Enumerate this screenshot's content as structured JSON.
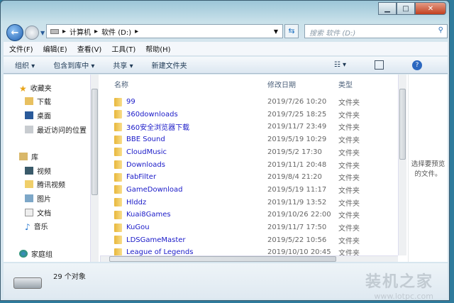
{
  "address": {
    "crumbs": [
      "计算机",
      "软件 (D:)"
    ]
  },
  "search": {
    "placeholder": "搜索 软件 (D:)"
  },
  "menu": [
    "文件(F)",
    "编辑(E)",
    "查看(V)",
    "工具(T)",
    "帮助(H)"
  ],
  "toolbar": {
    "organize": "组织 ▾",
    "include": "包含到库中 ▾",
    "share": "共享 ▾",
    "new_folder": "新建文件夹"
  },
  "nav": {
    "favorites": "收藏夹",
    "downloads": "下载",
    "desktop": "桌面",
    "recent": "最近访问的位置",
    "libraries": "库",
    "videos": "视频",
    "tencent_video": "腾讯视频",
    "pictures": "图片",
    "documents": "文档",
    "music": "音乐",
    "homegroup": "家庭组"
  },
  "columns": {
    "name": "名称",
    "date": "修改日期",
    "type": "类型"
  },
  "files": [
    {
      "name": "99",
      "date": "2019/7/26 10:20",
      "type": "文件夹"
    },
    {
      "name": "360downloads",
      "date": "2019/7/25 18:25",
      "type": "文件夹"
    },
    {
      "name": "360安全浏览器下载",
      "date": "2019/11/7 23:49",
      "type": "文件夹"
    },
    {
      "name": "BBE Sound",
      "date": "2019/5/19 10:29",
      "type": "文件夹"
    },
    {
      "name": "CloudMusic",
      "date": "2019/5/2 17:30",
      "type": "文件夹"
    },
    {
      "name": "Downloads",
      "date": "2019/11/1 20:48",
      "type": "文件夹"
    },
    {
      "name": "FabFilter",
      "date": "2019/8/4 21:20",
      "type": "文件夹"
    },
    {
      "name": "GameDownload",
      "date": "2019/5/19 11:17",
      "type": "文件夹"
    },
    {
      "name": "Hlddz",
      "date": "2019/11/9 13:52",
      "type": "文件夹"
    },
    {
      "name": "Kuai8Games",
      "date": "2019/10/26 22:00",
      "type": "文件夹"
    },
    {
      "name": "KuGou",
      "date": "2019/11/7 17:50",
      "type": "文件夹"
    },
    {
      "name": "LDSGameMaster",
      "date": "2019/5/22 10:56",
      "type": "文件夹"
    },
    {
      "name": "League of Legends",
      "date": "2019/10/10 20:45",
      "type": "文件夹"
    }
  ],
  "preview": {
    "text": "选择要预览的文件。"
  },
  "status": {
    "count": "29 个对象"
  },
  "watermark": {
    "brand": "装机之家",
    "url": "www.lotpc.com"
  }
}
